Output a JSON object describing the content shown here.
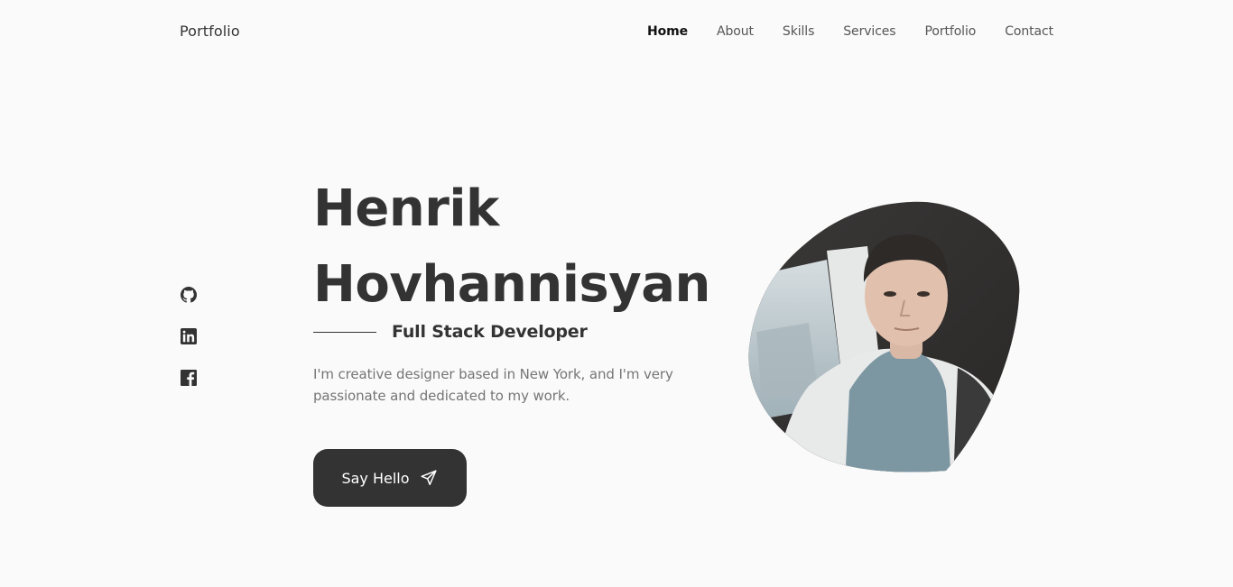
{
  "header": {
    "brand": "Portfolio",
    "nav": [
      {
        "label": "Home",
        "active": true
      },
      {
        "label": "About",
        "active": false
      },
      {
        "label": "Skills",
        "active": false
      },
      {
        "label": "Services",
        "active": false
      },
      {
        "label": "Portfolio",
        "active": false
      },
      {
        "label": "Contact",
        "active": false
      }
    ]
  },
  "social": [
    {
      "name": "github",
      "icon": "github-icon"
    },
    {
      "name": "linkedin",
      "icon": "linkedin-icon"
    },
    {
      "name": "facebook",
      "icon": "facebook-icon"
    }
  ],
  "hero": {
    "first_name": "Henrik",
    "last_name": "Hovhannisyan",
    "subtitle": "Full Stack Developer",
    "description": "I'm creative designer based in New York, and I'm very passionate and dedicated to my work.",
    "cta_label": "Say Hello",
    "cta_icon": "send-icon"
  },
  "colors": {
    "background": "#fafafa",
    "primary": "#333333",
    "text_muted": "#757575"
  }
}
